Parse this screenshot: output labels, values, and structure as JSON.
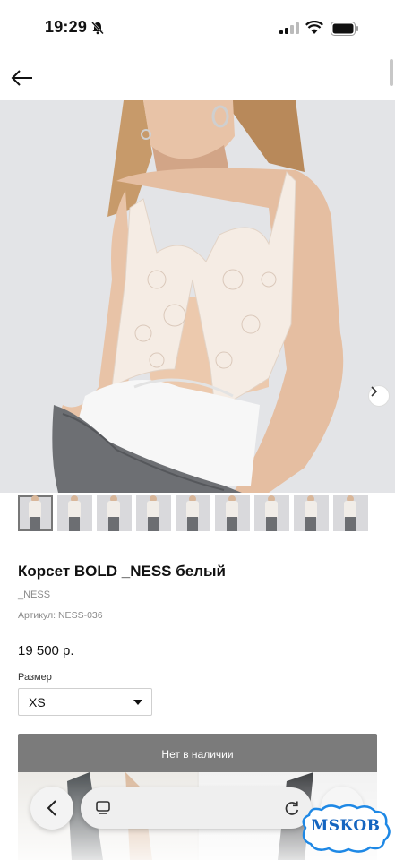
{
  "status_bar": {
    "time": "19:29",
    "icons": [
      "bell-slash-icon",
      "cellular-signal-icon",
      "wifi-icon",
      "battery-icon"
    ]
  },
  "header": {
    "back_icon": "arrow-left-icon"
  },
  "gallery": {
    "next_icon": "chevron-right-icon",
    "thumbnail_count": 9,
    "active_index": 0
  },
  "product": {
    "title": "Корсет BOLD _NESS белый",
    "brand": "_NESS",
    "article": "Артикул: NESS-036",
    "price": "19 500 р.",
    "size_label": "Размер",
    "size_value": "XS",
    "stock_button": "Нет в наличии"
  },
  "browser_bar": {
    "back_icon": "chevron-left-icon",
    "tabs_icon": "tabs-icon",
    "reload_icon": "reload-icon"
  },
  "watermark": {
    "text": "MSKOB"
  },
  "colors": {
    "stock_button_bg": "#7b7b7b",
    "hero_bg": "#e3e4e7",
    "watermark": "#1565c0"
  }
}
